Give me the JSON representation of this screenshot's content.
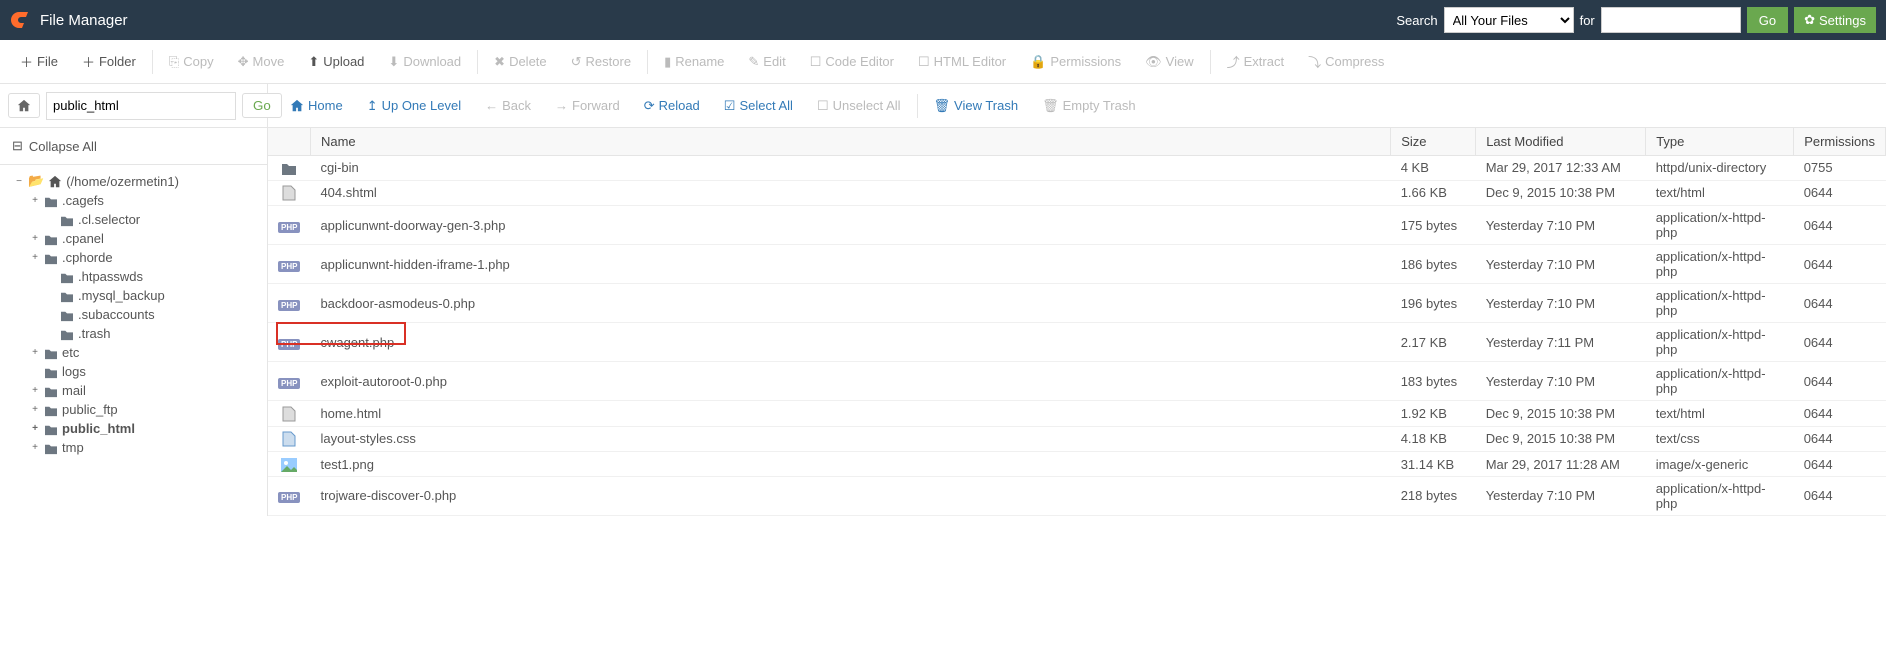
{
  "header": {
    "title": "File Manager",
    "search_label": "Search",
    "search_for": "for",
    "search_select": "All Your Files",
    "go": "Go",
    "settings": "Settings"
  },
  "toolbar": {
    "file": "File",
    "folder": "Folder",
    "copy": "Copy",
    "move": "Move",
    "upload": "Upload",
    "download": "Download",
    "delete": "Delete",
    "restore": "Restore",
    "rename": "Rename",
    "edit": "Edit",
    "code_editor": "Code Editor",
    "html_editor": "HTML Editor",
    "permissions": "Permissions",
    "view": "View",
    "extract": "Extract",
    "compress": "Compress"
  },
  "path": {
    "value": "public_html",
    "go": "Go"
  },
  "collapse_all": "Collapse All",
  "tree": {
    "root": "(/home/ozermetin1)",
    "items": [
      {
        "label": ".cagefs",
        "lvl": 2,
        "exp": "+"
      },
      {
        "label": ".cl.selector",
        "lvl": 3,
        "exp": ""
      },
      {
        "label": ".cpanel",
        "lvl": 2,
        "exp": "+"
      },
      {
        "label": ".cphorde",
        "lvl": 2,
        "exp": "+"
      },
      {
        "label": ".htpasswds",
        "lvl": 3,
        "exp": ""
      },
      {
        "label": ".mysql_backup",
        "lvl": 3,
        "exp": ""
      },
      {
        "label": ".subaccounts",
        "lvl": 3,
        "exp": ""
      },
      {
        "label": ".trash",
        "lvl": 3,
        "exp": ""
      },
      {
        "label": "etc",
        "lvl": 2,
        "exp": "+"
      },
      {
        "label": "logs",
        "lvl": 2,
        "exp": ""
      },
      {
        "label": "mail",
        "lvl": 2,
        "exp": "+"
      },
      {
        "label": "public_ftp",
        "lvl": 2,
        "exp": "+"
      },
      {
        "label": "public_html",
        "lvl": 2,
        "exp": "+",
        "bold": true
      },
      {
        "label": "tmp",
        "lvl": 2,
        "exp": "+"
      }
    ]
  },
  "actionbar": {
    "home": "Home",
    "up": "Up One Level",
    "back": "Back",
    "forward": "Forward",
    "reload": "Reload",
    "select_all": "Select All",
    "unselect_all": "Unselect All",
    "view_trash": "View Trash",
    "empty_trash": "Empty Trash"
  },
  "table": {
    "headers": {
      "name": "Name",
      "size": "Size",
      "modified": "Last Modified",
      "type": "Type",
      "permissions": "Permissions"
    },
    "rows": [
      {
        "icon": "folder",
        "name": "cgi-bin",
        "size": "4 KB",
        "modified": "Mar 29, 2017 12:33 AM",
        "type": "httpd/unix-directory",
        "perm": "0755"
      },
      {
        "icon": "html",
        "name": "404.shtml",
        "size": "1.66 KB",
        "modified": "Dec 9, 2015 10:38 PM",
        "type": "text/html",
        "perm": "0644"
      },
      {
        "icon": "php",
        "name": "applicunwnt-doorway-gen-3.php",
        "size": "175 bytes",
        "modified": "Yesterday 7:10 PM",
        "type": "application/x-httpd-php",
        "perm": "0644"
      },
      {
        "icon": "php",
        "name": "applicunwnt-hidden-iframe-1.php",
        "size": "186 bytes",
        "modified": "Yesterday 7:10 PM",
        "type": "application/x-httpd-php",
        "perm": "0644"
      },
      {
        "icon": "php",
        "name": "backdoor-asmodeus-0.php",
        "size": "196 bytes",
        "modified": "Yesterday 7:10 PM",
        "type": "application/x-httpd-php",
        "perm": "0644"
      },
      {
        "icon": "php",
        "name": "cwagent.php",
        "size": "2.17 KB",
        "modified": "Yesterday 7:11 PM",
        "type": "application/x-httpd-php",
        "perm": "0644",
        "highlight": true
      },
      {
        "icon": "php",
        "name": "exploit-autoroot-0.php",
        "size": "183 bytes",
        "modified": "Yesterday 7:10 PM",
        "type": "application/x-httpd-php",
        "perm": "0644"
      },
      {
        "icon": "html",
        "name": "home.html",
        "size": "1.92 KB",
        "modified": "Dec 9, 2015 10:38 PM",
        "type": "text/html",
        "perm": "0644"
      },
      {
        "icon": "css",
        "name": "layout-styles.css",
        "size": "4.18 KB",
        "modified": "Dec 9, 2015 10:38 PM",
        "type": "text/css",
        "perm": "0644"
      },
      {
        "icon": "img",
        "name": "test1.png",
        "size": "31.14 KB",
        "modified": "Mar 29, 2017 11:28 AM",
        "type": "image/x-generic",
        "perm": "0644"
      },
      {
        "icon": "php",
        "name": "trojware-discover-0.php",
        "size": "218 bytes",
        "modified": "Yesterday 7:10 PM",
        "type": "application/x-httpd-php",
        "perm": "0644"
      }
    ]
  }
}
